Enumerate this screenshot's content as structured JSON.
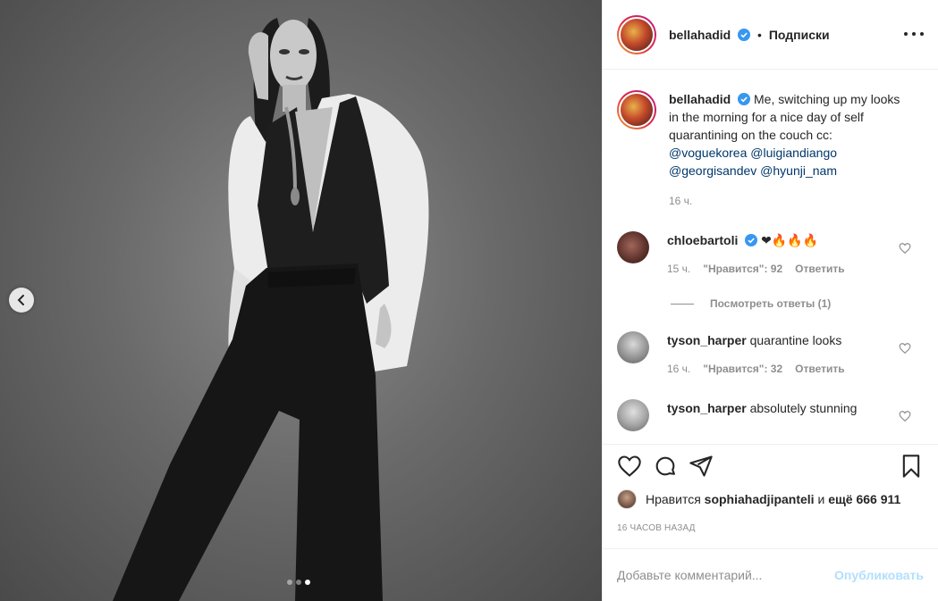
{
  "header": {
    "username": "bellahadid",
    "separator": "•",
    "follow_label": "Подписки"
  },
  "caption": {
    "username": "bellahadid",
    "text": "Me, switching up my looks in the morning for a nice day of self quarantining on the couch cc:",
    "mentions": [
      "@voguekorea",
      "@luigiandiango",
      "@georgisandev",
      "@hyunji_nam"
    ],
    "time": "16 ч."
  },
  "comments": [
    {
      "username": "chloebartoli",
      "verified": true,
      "text": "❤🔥🔥🔥",
      "time": "15 ч.",
      "likes_label": "\"Нравится\": 92",
      "reply_label": "Ответить",
      "view_replies": "Посмотреть ответы (1)"
    },
    {
      "username": "tyson_harper",
      "text": "quarantine looks",
      "time": "16 ч.",
      "likes_label": "\"Нравится\": 32",
      "reply_label": "Ответить"
    },
    {
      "username": "tyson_harper",
      "text": "absolutely stunning"
    }
  ],
  "likes": {
    "prefix": "Нравится",
    "user": "sophiahadjipanteli",
    "joiner": "и",
    "more": "ещё 666 911"
  },
  "timestamp": "16 ЧАСОВ НАЗАД",
  "add_comment": {
    "placeholder": "Добавьте комментарий...",
    "publish_label": "Опубликовать"
  },
  "carousel": {
    "total": 3,
    "active_index": 2
  },
  "colors": {
    "text": "#262626",
    "secondary": "#8e8e8e",
    "link": "#00376b",
    "verified": "#3897f0",
    "publish_disabled": "#b2dffc"
  },
  "icons": [
    "verified-badge-icon",
    "more-options-icon",
    "heart-icon",
    "comment-icon",
    "share-icon",
    "bookmark-icon",
    "chevron-left-icon"
  ]
}
